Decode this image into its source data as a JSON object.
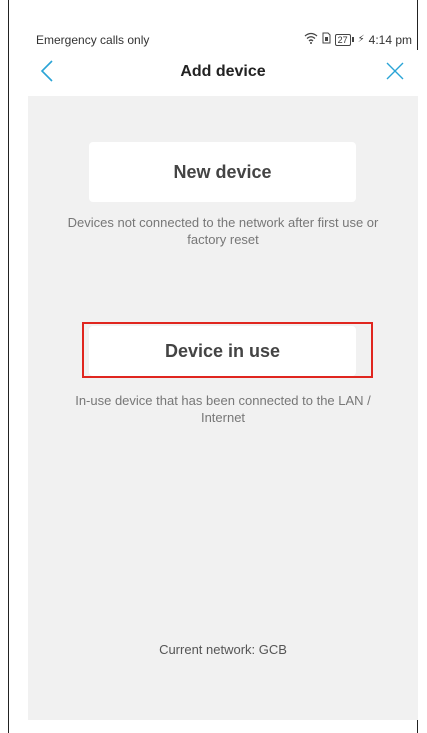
{
  "status_bar": {
    "carrier_text": "Emergency calls only",
    "battery_level": "27",
    "time": "4:14 pm",
    "icons": [
      "wifi-icon",
      "sim-icon",
      "battery-icon",
      "bolt-icon"
    ]
  },
  "header": {
    "title": "Add device",
    "back_icon": "chevron-left-icon",
    "close_icon": "close-icon",
    "accent_color": "#2aa4d6"
  },
  "options": [
    {
      "label": "New device",
      "description": "Devices not connected to the network after first use or factory reset"
    },
    {
      "label": "Device in use",
      "description": "In-use device that has been connected to the LAN / Internet",
      "highlighted": true,
      "highlight_color": "#e0261f"
    }
  ],
  "footer": {
    "network_text": "Current network: GCB"
  },
  "colors": {
    "background": "#f1f1f1",
    "card": "#ffffff"
  }
}
